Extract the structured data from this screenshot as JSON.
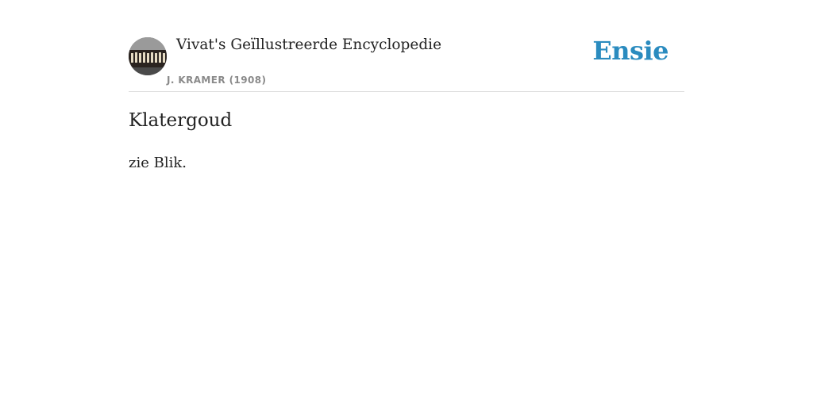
{
  "header": {
    "book_title": "Vivat's Geïllustreerde Encyclopedie",
    "author": "J. KRAMER (1908)",
    "brand": "Ensie",
    "brand_color": "#2a8bbf",
    "thumbnail_icon": "book-spines-icon"
  },
  "entry": {
    "title": "Klatergoud",
    "body": "zie Blik."
  }
}
